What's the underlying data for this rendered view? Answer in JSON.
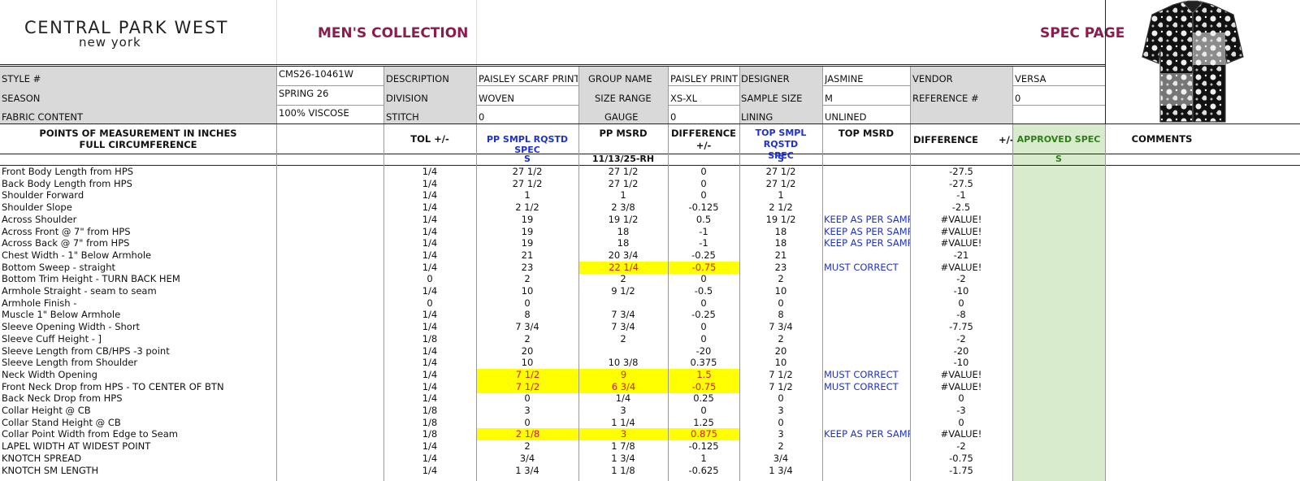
{
  "header": {
    "logo_line1": "CENTRAL PARK WEST",
    "logo_line2": "new york",
    "collection": "MEN'S COLLECTION",
    "page_title": "SPEC PAGE"
  },
  "info": {
    "style_label": "STYLE #",
    "style_value": "CMS26-10461W",
    "description_label": "DESCRIPTION",
    "description_value": "PAISLEY SCARF PRINT",
    "group_label": "GROUP NAME",
    "group_value": "PAISLEY PRINT",
    "designer_label": "DESIGNER",
    "designer_value": "JASMINE",
    "vendor_label": "VENDOR",
    "vendor_value": "VERSA",
    "season_label": "SEASON",
    "season_value": "SPRING 26",
    "division_label": "DIVISION",
    "division_value": "WOVEN",
    "size_range_label": "SIZE RANGE",
    "size_range_value": "XS-XL",
    "sample_size_label": "SAMPLE SIZE",
    "sample_size_value": "M",
    "reference_label": "REFERENCE #",
    "reference_value": "0",
    "fabric_label": "FABRIC CONTENT",
    "fabric_value": "100% VISCOSE",
    "stitch_label": "STITCH",
    "stitch_value": "0",
    "gauge_label": "GAUGE",
    "gauge_value": "0",
    "lining_label": "LINING",
    "lining_value": "UNLINED"
  },
  "columns": {
    "pom_line1": "POINTS OF MEASUREMENT IN INCHES",
    "pom_line2": "FULL CIRCUMFERENCE",
    "tol": "TOL +/-",
    "pp_rqstd": "PP SMPL  RQSTD SPEC",
    "pp_msrd": "PP MSRD",
    "diff1_line1": "DIFFERENCE",
    "diff1_line2": "+/-",
    "top_rqstd_line1": "TOP SMPL RQSTD",
    "top_rqstd_line2": "SPEC",
    "top_msrd": "TOP MSRD",
    "diff2": "DIFFERENCE",
    "diff2_pm": "+/-",
    "approved": "APPROVED SPEC",
    "comments": "COMMENTS"
  },
  "subheader": {
    "pp_size": "S",
    "pp_msrd_date": "11/13/25-RH",
    "top_size": "S",
    "approved_size": "S"
  },
  "rows": [
    {
      "pom": "Front Body Length from HPS",
      "tol": "1/4",
      "pp": "27 1/2",
      "msrd": "27 1/2",
      "diff": "0",
      "top": "27 1/2",
      "top_msrd": "",
      "diff2": "-27.5",
      "hl": []
    },
    {
      "pom": "Back Body Length from HPS",
      "tol": "1/4",
      "pp": "27 1/2",
      "msrd": "27 1/2",
      "diff": "0",
      "top": "27 1/2",
      "top_msrd": "",
      "diff2": "-27.5",
      "hl": []
    },
    {
      "pom": "Shoulder Forward",
      "tol": "1/4",
      "pp": "1",
      "msrd": "1",
      "diff": "0",
      "top": "1",
      "top_msrd": "",
      "diff2": "-1",
      "hl": []
    },
    {
      "pom": "Shoulder Slope",
      "tol": "1/4",
      "pp": "2 1/2",
      "msrd": "2 3/8",
      "diff": "-0.125",
      "top": "2 1/2",
      "top_msrd": "",
      "diff2": "-2.5",
      "hl": []
    },
    {
      "pom": "Across Shoulder",
      "tol": "1/4",
      "pp": "19",
      "msrd": "19 1/2",
      "diff": "0.5",
      "top": "19 1/2",
      "top_msrd": "KEEP AS PER SAMPLE",
      "diff2": "#VALUE!",
      "hl": []
    },
    {
      "pom": "Across Front @ 7\" from HPS",
      "tol": "1/4",
      "pp": "19",
      "msrd": "18",
      "diff": "-1",
      "top": "18",
      "top_msrd": "KEEP AS PER SAMPLE",
      "diff2": "#VALUE!",
      "hl": []
    },
    {
      "pom": "Across Back @ 7\" from HPS",
      "tol": "1/4",
      "pp": "19",
      "msrd": "18",
      "diff": "-1",
      "top": "18",
      "top_msrd": "KEEP AS PER SAMPLE",
      "diff2": "#VALUE!",
      "hl": []
    },
    {
      "pom": "Chest Width - 1\" Below Armhole",
      "tol": "1/4",
      "pp": "21",
      "msrd": "20 3/4",
      "diff": "-0.25",
      "top": "21",
      "top_msrd": "",
      "diff2": "-21",
      "hl": []
    },
    {
      "pom": "Bottom Sweep - straight",
      "tol": "1/4",
      "pp": "23",
      "msrd": "22 1/4",
      "diff": "-0.75",
      "top": "23",
      "top_msrd": "MUST CORRECT",
      "diff2": "#VALUE!",
      "hl": [
        "msrd",
        "diff"
      ]
    },
    {
      "pom": "Bottom Trim Height - TURN BACK HEM",
      "tol": "0",
      "pp": "2",
      "msrd": "2",
      "diff": "0",
      "top": "2",
      "top_msrd": "",
      "diff2": "-2",
      "hl": []
    },
    {
      "pom": "Armhole Straight - seam to seam",
      "tol": "1/4",
      "pp": "10",
      "msrd": "9 1/2",
      "diff": "-0.5",
      "top": "10",
      "top_msrd": "",
      "diff2": "-10",
      "hl": []
    },
    {
      "pom": "Armhole  Finish -",
      "tol": "0",
      "pp": "0",
      "msrd": "",
      "diff": "0",
      "top": "0",
      "top_msrd": "",
      "diff2": "0",
      "hl": []
    },
    {
      "pom": "Muscle 1\" Below Armhole",
      "tol": "1/4",
      "pp": "8",
      "msrd": "7 3/4",
      "diff": "-0.25",
      "top": "8",
      "top_msrd": "",
      "diff2": "-8",
      "hl": []
    },
    {
      "pom": "Sleeve Opening Width - Short",
      "tol": "1/4",
      "pp": "7 3/4",
      "msrd": "7 3/4",
      "diff": "0",
      "top": "7 3/4",
      "top_msrd": "",
      "diff2": "-7.75",
      "hl": []
    },
    {
      "pom": "Sleeve Cuff Height - ]",
      "tol": "1/8",
      "pp": "2",
      "msrd": "2",
      "diff": "0",
      "top": "2",
      "top_msrd": "",
      "diff2": "-2",
      "hl": []
    },
    {
      "pom": "Sleeve Length from CB/HPS -3 point",
      "tol": "1/4",
      "pp": "20",
      "msrd": "",
      "diff": "-20",
      "top": "20",
      "top_msrd": "",
      "diff2": "-20",
      "hl": []
    },
    {
      "pom": "Sleeve Length from Shoulder",
      "tol": "1/4",
      "pp": "10",
      "msrd": "10 3/8",
      "diff": "0.375",
      "top": "10",
      "top_msrd": "",
      "diff2": "-10",
      "hl": []
    },
    {
      "pom": "Neck Width Opening",
      "tol": "1/4",
      "pp": "7 1/2",
      "msrd": "9",
      "diff": "1.5",
      "top": "7 1/2",
      "top_msrd": "MUST CORRECT",
      "diff2": "#VALUE!",
      "hl": [
        "pp",
        "msrd",
        "diff"
      ]
    },
    {
      "pom": "Front Neck Drop from HPS - TO CENTER OF BTN",
      "tol": "1/4",
      "pp": "7 1/2",
      "msrd": "6 3/4",
      "diff": "-0.75",
      "top": "7 1/2",
      "top_msrd": "MUST CORRECT",
      "diff2": "#VALUE!",
      "hl": [
        "pp",
        "msrd",
        "diff"
      ]
    },
    {
      "pom": "Back Neck Drop from HPS",
      "tol": "1/4",
      "pp": "0",
      "msrd": "1/4",
      "diff": "0.25",
      "top": "0",
      "top_msrd": "",
      "diff2": "0",
      "hl": []
    },
    {
      "pom": "Collar Height @ CB",
      "tol": "1/8",
      "pp": "3",
      "msrd": "3",
      "diff": "0",
      "top": "3",
      "top_msrd": "",
      "diff2": "-3",
      "hl": []
    },
    {
      "pom": "Collar Stand Height @ CB",
      "tol": "1/8",
      "pp": "0",
      "msrd": "1 1/4",
      "diff": "1.25",
      "top": "0",
      "top_msrd": "",
      "diff2": "0",
      "hl": []
    },
    {
      "pom": "Collar Point Width from Edge to Seam",
      "tol": "1/8",
      "pp": "2 1/8",
      "msrd": "3",
      "diff": "0.875",
      "top": "3",
      "top_msrd": "KEEP AS PER SAMPLE",
      "diff2": "#VALUE!",
      "hl": [
        "pp",
        "msrd",
        "diff"
      ]
    },
    {
      "pom": "LAPEL WIDTH AT WIDEST POINT",
      "tol": "1/4",
      "pp": "2",
      "msrd": "1 7/8",
      "diff": "-0.125",
      "top": "2",
      "top_msrd": "",
      "diff2": "-2",
      "hl": []
    },
    {
      "pom": "KNOTCH SPREAD",
      "tol": "1/4",
      "pp": "3/4",
      "msrd": "1 3/4",
      "diff": "1",
      "top": "3/4",
      "top_msrd": "",
      "diff2": "-0.75",
      "hl": []
    },
    {
      "pom": "KNOTCH SM LENGTH",
      "tol": "1/4",
      "pp": "1 3/4",
      "msrd": "1 1/8",
      "diff": "-0.625",
      "top": "1 3/4",
      "top_msrd": "",
      "diff2": "-1.75",
      "hl": []
    }
  ]
}
